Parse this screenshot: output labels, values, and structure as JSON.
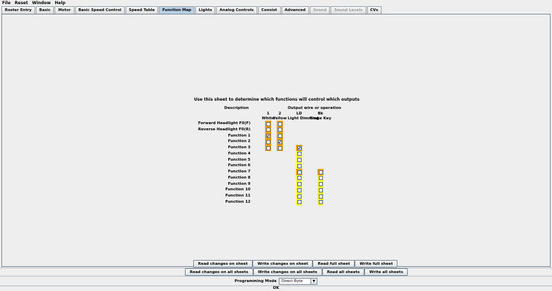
{
  "menu": [
    "File",
    "Reset",
    "Window",
    "Help"
  ],
  "tabs": [
    {
      "label": "Roster Entry",
      "state": "normal"
    },
    {
      "label": "Basic",
      "state": "normal"
    },
    {
      "label": "Motor",
      "state": "normal"
    },
    {
      "label": "Basic Speed Control",
      "state": "normal"
    },
    {
      "label": "Speed Table",
      "state": "normal"
    },
    {
      "label": "Function Map",
      "state": "active"
    },
    {
      "label": "Lights",
      "state": "normal"
    },
    {
      "label": "Analog Controls",
      "state": "normal"
    },
    {
      "label": "Consist",
      "state": "normal"
    },
    {
      "label": "Advanced",
      "state": "normal"
    },
    {
      "label": "Sound",
      "state": "disabled"
    },
    {
      "label": "Sound Levels",
      "state": "disabled"
    },
    {
      "label": "CVs",
      "state": "normal"
    }
  ],
  "function_map": {
    "intro": "Use this sheet to determine which functions will control which outputs",
    "description_header": "Description",
    "outputs_header": "Output wire or operation",
    "columns": [
      {
        "number": "1",
        "name": "White"
      },
      {
        "number": "2",
        "name": "Yellow"
      },
      {
        "number": "LD",
        "name": "Light Dimming"
      },
      {
        "number": "Bk",
        "name": "Brake Key"
      }
    ],
    "rows": [
      {
        "label": "Forward Headlight F0(F)",
        "cells": [
          {
            "c": "orange",
            "v": false
          },
          {
            "c": "orange",
            "v": false
          },
          null,
          null
        ]
      },
      {
        "label": "Reverse Headlight F0(R)",
        "cells": [
          {
            "c": "orange",
            "v": false
          },
          {
            "c": "orange",
            "v": false
          },
          null,
          null
        ]
      },
      {
        "label": "Function 1",
        "cells": [
          {
            "c": "orange",
            "v": true
          },
          {
            "c": "orange",
            "v": false
          },
          null,
          null
        ]
      },
      {
        "label": "Function 2",
        "cells": [
          {
            "c": "orange",
            "v": false
          },
          {
            "c": "orange",
            "v": true
          },
          null,
          null
        ]
      },
      {
        "label": "Function 3",
        "cells": [
          {
            "c": "orange",
            "v": false
          },
          {
            "c": "orange",
            "v": false
          },
          {
            "c": "orange",
            "v": true
          },
          null
        ]
      },
      {
        "label": "Function 4",
        "cells": [
          null,
          null,
          {
            "c": "yellow",
            "v": false
          },
          null
        ]
      },
      {
        "label": "Function 5",
        "cells": [
          null,
          null,
          {
            "c": "yellow",
            "v": false
          },
          null
        ]
      },
      {
        "label": "Function 6",
        "cells": [
          null,
          null,
          {
            "c": "yellow",
            "v": false
          },
          null
        ]
      },
      {
        "label": "Function 7",
        "cells": [
          null,
          null,
          {
            "c": "orange",
            "v": false
          },
          {
            "c": "orange",
            "v": false
          }
        ]
      },
      {
        "label": "Function 8",
        "cells": [
          null,
          null,
          {
            "c": "yellow",
            "v": false
          },
          {
            "c": "yellow",
            "v": false
          }
        ]
      },
      {
        "label": "Function 9",
        "cells": [
          null,
          null,
          {
            "c": "yellow",
            "v": false
          },
          {
            "c": "yellow",
            "v": false
          }
        ]
      },
      {
        "label": "Function 10",
        "cells": [
          null,
          null,
          {
            "c": "yellow",
            "v": false
          },
          {
            "c": "yellow",
            "v": false
          }
        ]
      },
      {
        "label": "Function 11",
        "cells": [
          null,
          null,
          {
            "c": "yellow",
            "v": false
          },
          {
            "c": "yellow",
            "v": false
          }
        ]
      },
      {
        "label": "Function 12",
        "cells": [
          null,
          null,
          {
            "c": "yellow",
            "v": false
          },
          {
            "c": "yellow",
            "v": false
          }
        ]
      }
    ]
  },
  "sheet_buttons": [
    "Read changes on sheet",
    "Write changes on sheet",
    "Read full sheet",
    "Write full sheet"
  ],
  "all_buttons": [
    "Read changes on all sheets",
    "Write changes on all sheets",
    "Read all sheets",
    "Write all sheets"
  ],
  "programming": {
    "label": "Programming Mode",
    "value": "Direct Byte"
  },
  "ok_label": "OK",
  "colors": {
    "orange": "#f2a000",
    "yellow": "#ffff40",
    "active_tab": "#b8cfe5"
  }
}
